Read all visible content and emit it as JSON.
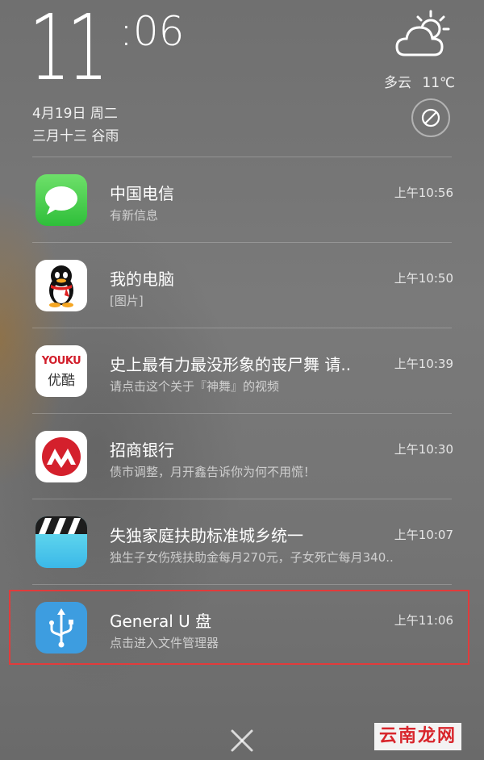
{
  "lockscreen": {
    "time_hours": "11",
    "time_minutes": ":06",
    "date": "4月19日 周二",
    "lunar_date": "三月十三 谷雨",
    "weather": {
      "condition": "多云",
      "temperature": "11℃",
      "icon": "partly-cloudy-icon"
    },
    "dnd_icon": "do-not-disturb-icon"
  },
  "notifications": [
    {
      "app_icon": "messages-icon",
      "title": "中国电信",
      "subtitle": "有新信息",
      "time": "上午10:56"
    },
    {
      "app_icon": "qq-icon",
      "title": "我的电脑",
      "subtitle": "[图片]",
      "time": "上午10:50"
    },
    {
      "app_icon": "youku-icon",
      "icon_text": [
        "YOUKU",
        "优酷"
      ],
      "title": "史上最有力最没形象的丧尸舞 请..",
      "subtitle": "请点击这个关于『神舞』的视频",
      "time": "上午10:39"
    },
    {
      "app_icon": "cmb-bank-icon",
      "title": "招商银行",
      "subtitle": "债市调整，月开鑫告诉你为何不用慌！",
      "time": "上午10:30"
    },
    {
      "app_icon": "video-clapper-icon",
      "title": "失独家庭扶助标准城乡统一",
      "subtitle": "独生子女伤残扶助金每月270元，子女死亡每月340..",
      "time": "上午10:07"
    },
    {
      "app_icon": "usb-icon",
      "title": "General U 盘",
      "subtitle": "点击进入文件管理器",
      "time": "上午11:06",
      "highlighted": true
    }
  ],
  "colors": {
    "highlight_border": "#e23b3b",
    "watermark_text": "#d8262c"
  },
  "close_icon": "close-icon",
  "watermark": "云南龙网"
}
